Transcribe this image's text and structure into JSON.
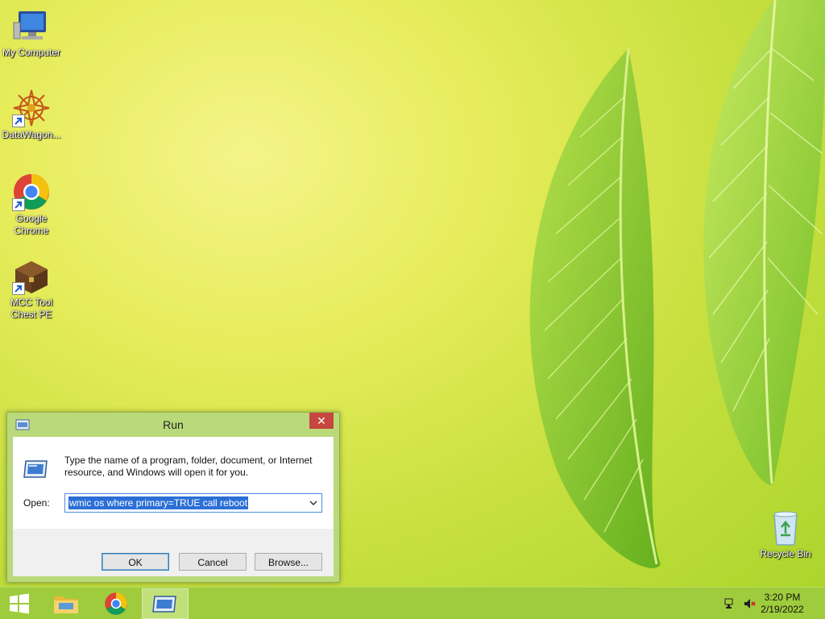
{
  "desktop": {
    "icons": [
      {
        "label": "My Computer",
        "icon": "computer-icon"
      },
      {
        "label": "DataWagon...",
        "icon": "datawagon-icon"
      },
      {
        "label": "Google Chrome",
        "icon": "chrome-icon"
      },
      {
        "label": "MCC Tool Chest PE",
        "icon": "chest-icon"
      },
      {
        "label": "Recycle Bin",
        "icon": "recycle-bin-icon"
      }
    ]
  },
  "run_dialog": {
    "title": "Run",
    "close_label": "✕",
    "description": "Type the name of a program, folder, document, or Internet resource, and Windows will open it for you.",
    "open_label": "Open:",
    "open_value": "wmic os where primary=TRUE call reboot",
    "buttons": {
      "ok": "OK",
      "cancel": "Cancel",
      "browse": "Browse..."
    }
  },
  "taskbar": {
    "items": [
      {
        "name": "start",
        "icon": "windows-logo-icon"
      },
      {
        "name": "file-explorer",
        "icon": "folder-icon"
      },
      {
        "name": "chrome",
        "icon": "chrome-icon"
      },
      {
        "name": "run",
        "icon": "run-icon",
        "active": true
      }
    ],
    "clock": {
      "time": "3:20 PM",
      "date": "2/19/2022"
    }
  },
  "colors": {
    "taskbar": "#9fcc3c",
    "dialog_frame": "#b9d97a",
    "close_button": "#c7463f",
    "selection": "#2b6fd6"
  }
}
